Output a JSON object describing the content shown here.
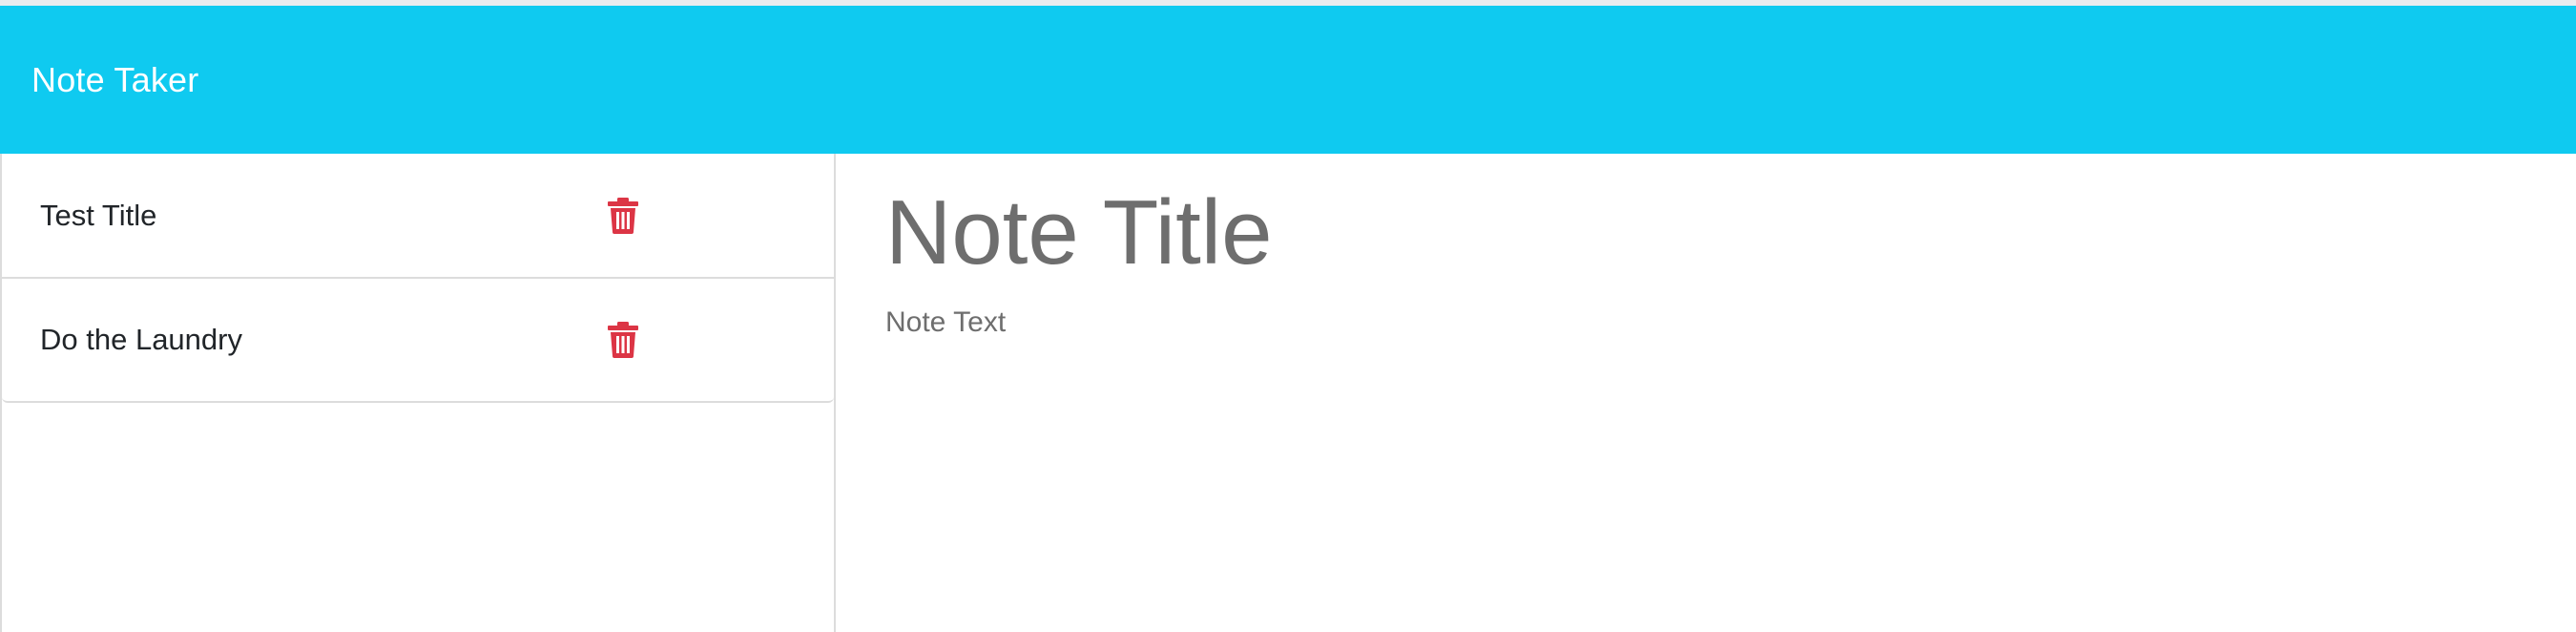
{
  "app": {
    "title": "Note Taker"
  },
  "colors": {
    "navbar": "#0fcaf0",
    "delete_icon": "#dc3545",
    "placeholder_text": "#6e6e6e"
  },
  "sidebar": {
    "notes": [
      {
        "title": "Test Title",
        "delete_icon": "trash-icon"
      },
      {
        "title": "Do the Laundry",
        "delete_icon": "trash-icon"
      }
    ]
  },
  "editor": {
    "title_value": "",
    "title_placeholder": "Note Title",
    "text_value": "",
    "text_placeholder": "Note Text"
  }
}
